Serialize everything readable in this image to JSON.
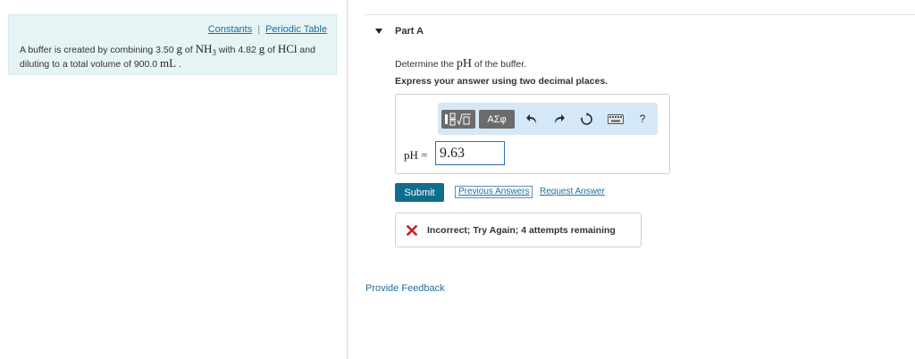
{
  "resources": {
    "constants": "Constants",
    "separator": "|",
    "periodic_table": "Periodic Table"
  },
  "problem": {
    "t1": "A buffer is created by combining 3.50 ",
    "g1": "g",
    "t2": " of ",
    "nh3": "NH",
    "nh3_sub": "3",
    "t3": " with 4.82 ",
    "g2": "g",
    "t4": " of ",
    "hcl": "HCl",
    "t5": " and",
    "t6": "diluting to a total volume of 900.0 ",
    "ml": "mL",
    "t7": " ."
  },
  "part": {
    "label": "Part A",
    "question_pre": "Determine the ",
    "question_ph": "pH",
    "question_post": " of the buffer.",
    "instruction": "Express your answer using two decimal places."
  },
  "toolbar": {
    "greek_label": "ΑΣφ",
    "help_label": "?"
  },
  "answer": {
    "label": "pH =",
    "value": "9.63"
  },
  "actions": {
    "submit": "Submit",
    "previous_answers": "Previous Answers",
    "request_answer": "Request Answer"
  },
  "feedback": {
    "status": "Incorrect; Try Again; 4 attempts remaining",
    "status_color": "#cc1f1f"
  },
  "footer": {
    "provide_feedback": "Provide Feedback"
  },
  "colors": {
    "panel_bg": "#e6f4f5",
    "link": "#1a6fa0",
    "submit_bg": "#0f6e8e",
    "toolbar_bg": "#d4e8f8"
  }
}
